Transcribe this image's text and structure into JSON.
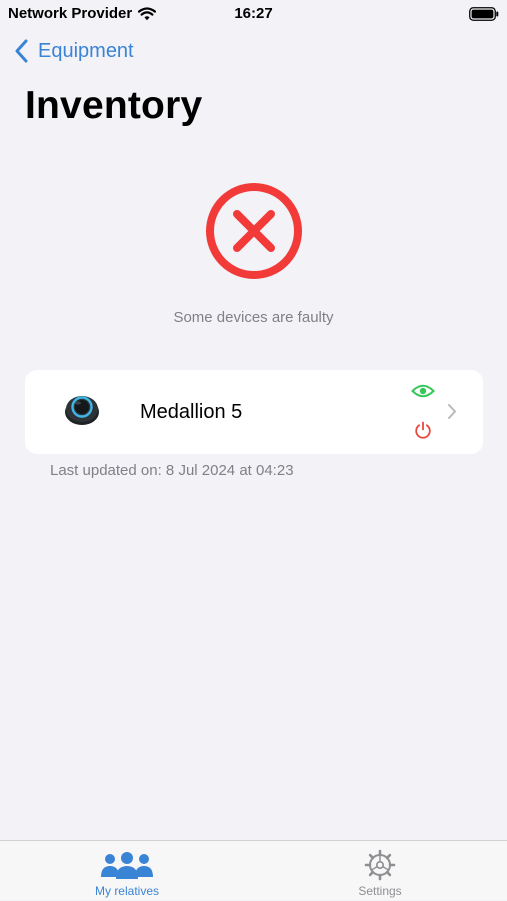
{
  "status_bar": {
    "carrier": "Network Provider",
    "time": "16:27"
  },
  "nav": {
    "back_label": "Equipment",
    "title": "Inventory"
  },
  "status": {
    "message": "Some devices are faulty",
    "icon": "error-x-circle-icon",
    "color": "#f23b39"
  },
  "device": {
    "name": "Medallion 5",
    "image": "medallion-device",
    "status_icons": [
      "eye-icon",
      "power-icon"
    ],
    "eye_color": "#34c759",
    "power_color": "#e8483e",
    "last_updated": "Last updated on: 8 Jul 2024 at 04:23"
  },
  "tabs": [
    {
      "label": "My relatives",
      "icon": "people-icon",
      "active": true
    },
    {
      "label": "Settings",
      "icon": "gear-icon",
      "active": false
    }
  ],
  "colors": {
    "accent": "#3a84d6",
    "background": "#f2f2f7"
  }
}
